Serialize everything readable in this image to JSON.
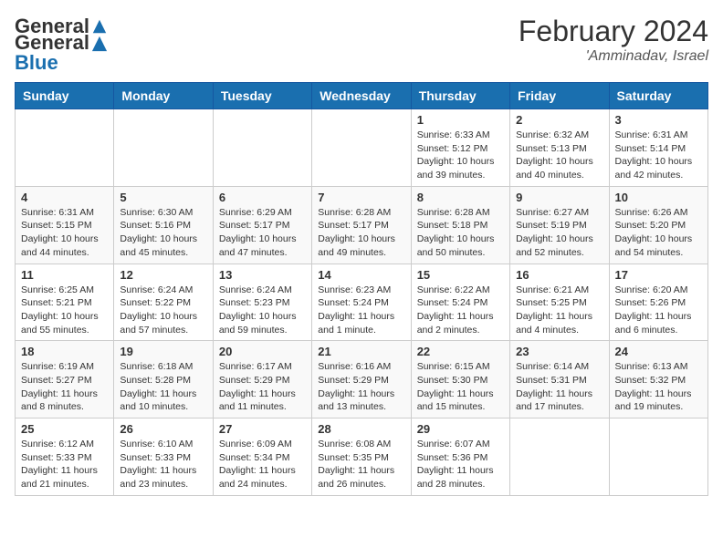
{
  "header": {
    "logo_general": "General",
    "logo_blue": "Blue",
    "month_year": "February 2024",
    "location": "'Amminadav, Israel"
  },
  "days_of_week": [
    "Sunday",
    "Monday",
    "Tuesday",
    "Wednesday",
    "Thursday",
    "Friday",
    "Saturday"
  ],
  "weeks": [
    [
      {
        "day": "",
        "info": ""
      },
      {
        "day": "",
        "info": ""
      },
      {
        "day": "",
        "info": ""
      },
      {
        "day": "",
        "info": ""
      },
      {
        "day": "1",
        "info": "Sunrise: 6:33 AM\nSunset: 5:12 PM\nDaylight: 10 hours and 39 minutes."
      },
      {
        "day": "2",
        "info": "Sunrise: 6:32 AM\nSunset: 5:13 PM\nDaylight: 10 hours and 40 minutes."
      },
      {
        "day": "3",
        "info": "Sunrise: 6:31 AM\nSunset: 5:14 PM\nDaylight: 10 hours and 42 minutes."
      }
    ],
    [
      {
        "day": "4",
        "info": "Sunrise: 6:31 AM\nSunset: 5:15 PM\nDaylight: 10 hours and 44 minutes."
      },
      {
        "day": "5",
        "info": "Sunrise: 6:30 AM\nSunset: 5:16 PM\nDaylight: 10 hours and 45 minutes."
      },
      {
        "day": "6",
        "info": "Sunrise: 6:29 AM\nSunset: 5:17 PM\nDaylight: 10 hours and 47 minutes."
      },
      {
        "day": "7",
        "info": "Sunrise: 6:28 AM\nSunset: 5:17 PM\nDaylight: 10 hours and 49 minutes."
      },
      {
        "day": "8",
        "info": "Sunrise: 6:28 AM\nSunset: 5:18 PM\nDaylight: 10 hours and 50 minutes."
      },
      {
        "day": "9",
        "info": "Sunrise: 6:27 AM\nSunset: 5:19 PM\nDaylight: 10 hours and 52 minutes."
      },
      {
        "day": "10",
        "info": "Sunrise: 6:26 AM\nSunset: 5:20 PM\nDaylight: 10 hours and 54 minutes."
      }
    ],
    [
      {
        "day": "11",
        "info": "Sunrise: 6:25 AM\nSunset: 5:21 PM\nDaylight: 10 hours and 55 minutes."
      },
      {
        "day": "12",
        "info": "Sunrise: 6:24 AM\nSunset: 5:22 PM\nDaylight: 10 hours and 57 minutes."
      },
      {
        "day": "13",
        "info": "Sunrise: 6:24 AM\nSunset: 5:23 PM\nDaylight: 10 hours and 59 minutes."
      },
      {
        "day": "14",
        "info": "Sunrise: 6:23 AM\nSunset: 5:24 PM\nDaylight: 11 hours and 1 minute."
      },
      {
        "day": "15",
        "info": "Sunrise: 6:22 AM\nSunset: 5:24 PM\nDaylight: 11 hours and 2 minutes."
      },
      {
        "day": "16",
        "info": "Sunrise: 6:21 AM\nSunset: 5:25 PM\nDaylight: 11 hours and 4 minutes."
      },
      {
        "day": "17",
        "info": "Sunrise: 6:20 AM\nSunset: 5:26 PM\nDaylight: 11 hours and 6 minutes."
      }
    ],
    [
      {
        "day": "18",
        "info": "Sunrise: 6:19 AM\nSunset: 5:27 PM\nDaylight: 11 hours and 8 minutes."
      },
      {
        "day": "19",
        "info": "Sunrise: 6:18 AM\nSunset: 5:28 PM\nDaylight: 11 hours and 10 minutes."
      },
      {
        "day": "20",
        "info": "Sunrise: 6:17 AM\nSunset: 5:29 PM\nDaylight: 11 hours and 11 minutes."
      },
      {
        "day": "21",
        "info": "Sunrise: 6:16 AM\nSunset: 5:29 PM\nDaylight: 11 hours and 13 minutes."
      },
      {
        "day": "22",
        "info": "Sunrise: 6:15 AM\nSunset: 5:30 PM\nDaylight: 11 hours and 15 minutes."
      },
      {
        "day": "23",
        "info": "Sunrise: 6:14 AM\nSunset: 5:31 PM\nDaylight: 11 hours and 17 minutes."
      },
      {
        "day": "24",
        "info": "Sunrise: 6:13 AM\nSunset: 5:32 PM\nDaylight: 11 hours and 19 minutes."
      }
    ],
    [
      {
        "day": "25",
        "info": "Sunrise: 6:12 AM\nSunset: 5:33 PM\nDaylight: 11 hours and 21 minutes."
      },
      {
        "day": "26",
        "info": "Sunrise: 6:10 AM\nSunset: 5:33 PM\nDaylight: 11 hours and 23 minutes."
      },
      {
        "day": "27",
        "info": "Sunrise: 6:09 AM\nSunset: 5:34 PM\nDaylight: 11 hours and 24 minutes."
      },
      {
        "day": "28",
        "info": "Sunrise: 6:08 AM\nSunset: 5:35 PM\nDaylight: 11 hours and 26 minutes."
      },
      {
        "day": "29",
        "info": "Sunrise: 6:07 AM\nSunset: 5:36 PM\nDaylight: 11 hours and 28 minutes."
      },
      {
        "day": "",
        "info": ""
      },
      {
        "day": "",
        "info": ""
      }
    ]
  ]
}
